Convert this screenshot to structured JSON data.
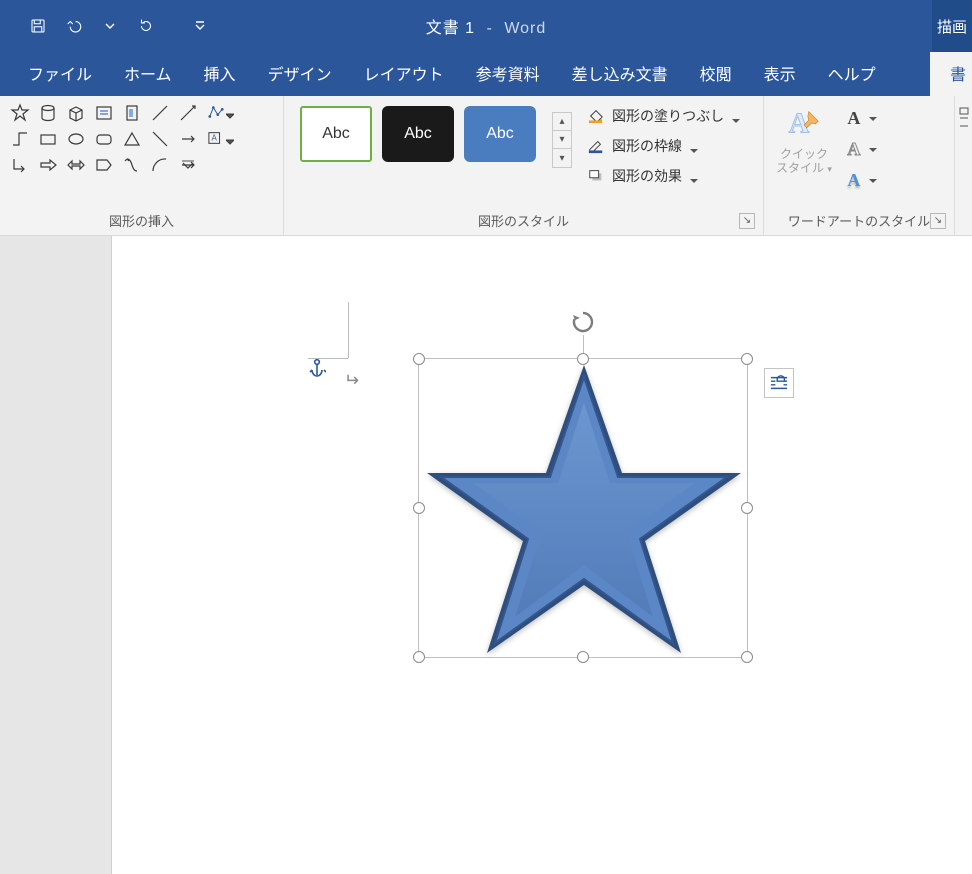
{
  "title": {
    "doc": "文書 1",
    "dash": "-",
    "app": "Word"
  },
  "context_tab": "描画",
  "tabs": {
    "file": "ファイル",
    "home": "ホーム",
    "insert": "挿入",
    "design": "デザイン",
    "layout": "レイアウト",
    "references": "参考資料",
    "mailings": "差し込み文書",
    "review": "校閲",
    "view": "表示",
    "help": "ヘルプ",
    "format": "書"
  },
  "groups": {
    "insert_shapes": "図形の挿入",
    "shape_styles": "図形のスタイル",
    "wordart_styles": "ワードアートのスタイル"
  },
  "style_thumb_label": "Abc",
  "shape_cmds": {
    "fill": "図形の塗りつぶし",
    "outline": "図形の枠線",
    "effects": "図形の効果"
  },
  "quick_styles": {
    "line1": "クイック",
    "line2": "スタイル"
  },
  "wordart_glyph": "A",
  "paragraph_mark": "↵"
}
